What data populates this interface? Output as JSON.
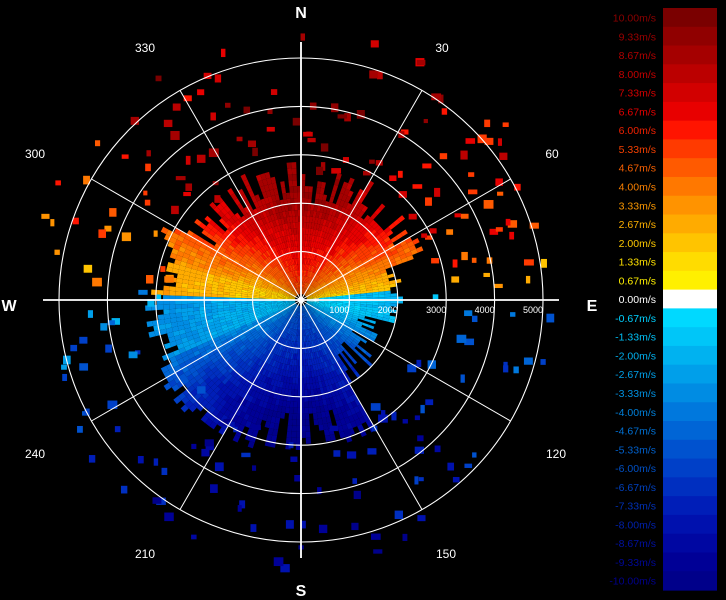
{
  "compass": {
    "north": "N",
    "south": "S",
    "east": "E",
    "west": "W"
  },
  "bearings": [
    "30",
    "60",
    "120",
    "150",
    "210",
    "240",
    "300",
    "330"
  ],
  "range_labels": [
    "1000",
    "2000",
    "3000",
    "4000",
    "5000"
  ],
  "legend": {
    "labels": [
      "10.00m/s",
      "9.33m/s",
      "8.67m/s",
      "8.00m/s",
      "7.33m/s",
      "6.67m/s",
      "6.00m/s",
      "5.33m/s",
      "4.67m/s",
      "4.00m/s",
      "3.33m/s",
      "2.67m/s",
      "2.00m/s",
      "1.33m/s",
      "0.67m/s",
      "0.00m/s",
      "-0.67m/s",
      "-1.33m/s",
      "-2.00m/s",
      "-2.67m/s",
      "-3.33m/s",
      "-4.00m/s",
      "-4.67m/s",
      "-5.33m/s",
      "-6.00m/s",
      "-6.67m/s",
      "-7.33m/s",
      "-8.00m/s",
      "-8.67m/s",
      "-9.33m/s",
      "-10.00m/s"
    ],
    "colors": [
      "#7a0000",
      "#900000",
      "#a50000",
      "#bb0000",
      "#d20000",
      "#e80000",
      "#ff1400",
      "#ff3a00",
      "#ff5a00",
      "#ff7800",
      "#ff9300",
      "#ffab00",
      "#ffc400",
      "#ffdc00",
      "#fff000",
      "#ffffff",
      "#00d9ff",
      "#00c6f8",
      "#00b2f0",
      "#009fea",
      "#008ce3",
      "#0078dd",
      "#0065d6",
      "#0052cf",
      "#0040c8",
      "#002fc0",
      "#001eb8",
      "#0011ae",
      "#0007a2",
      "#000096",
      "#00008a"
    ],
    "text_colors": [
      "#8b0000",
      "#9c0000",
      "#b00000",
      "#c40000",
      "#d40000",
      "#e40000",
      "#f02000",
      "#f54000",
      "#f86000",
      "#fa8000",
      "#fb9800",
      "#fdb000",
      "#fdc800",
      "#fee000",
      "#fff000",
      "#ffffff",
      "#00d0ff",
      "#00c0f5",
      "#00b0ee",
      "#00a0e8",
      "#0090e0",
      "#0080da",
      "#0070d3",
      "#0060cc",
      "#0050c5",
      "#0040bd",
      "#0030b5",
      "#0020ab",
      "#0010a0",
      "#000896",
      "#00008c"
    ]
  }
}
